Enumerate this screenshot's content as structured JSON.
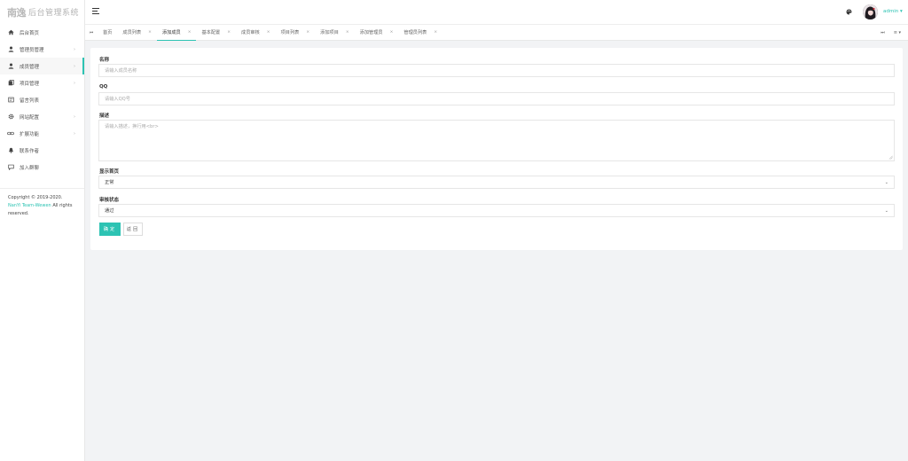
{
  "sidebar": {
    "logo_mark": "南逸",
    "logo_text": "后台管理系统",
    "items": [
      {
        "label": "后台首页",
        "icon": "home-icon",
        "arrow": false
      },
      {
        "label": "管理员管理",
        "icon": "user-icon",
        "arrow": true
      },
      {
        "label": "成员管理",
        "icon": "user-icon",
        "arrow": true
      },
      {
        "label": "项目管理",
        "icon": "project-icon",
        "arrow": true
      },
      {
        "label": "留言列表",
        "icon": "message-icon",
        "arrow": false
      },
      {
        "label": "网站配置",
        "icon": "gear-icon",
        "arrow": true
      },
      {
        "label": "扩展功能",
        "icon": "link-icon",
        "arrow": true
      },
      {
        "label": "联系作者",
        "icon": "bell-icon",
        "arrow": false
      },
      {
        "label": "加入群聊",
        "icon": "chat-icon",
        "arrow": false
      }
    ],
    "active_index": 2,
    "copyright": {
      "prefix": "Copyright © 2019-2020.",
      "link": "NanYi Team-Wewen",
      "suffix": "All rights reserved."
    }
  },
  "header": {
    "user_name": "admin ▾"
  },
  "tabs": {
    "left_scroll": "⏮",
    "items": [
      {
        "label": "首页",
        "closable": false
      },
      {
        "label": "成员列表",
        "closable": true
      },
      {
        "label": "添加成员",
        "closable": true
      },
      {
        "label": "基本配置",
        "closable": true
      },
      {
        "label": "成员审核",
        "closable": true
      },
      {
        "label": "项目列表",
        "closable": true
      },
      {
        "label": "添加项目",
        "closable": true
      },
      {
        "label": "添加管理员",
        "closable": true
      },
      {
        "label": "管理员列表",
        "closable": true
      }
    ],
    "active_index": 2,
    "close_glyph": "×",
    "right_scroll": "⏭",
    "menu": "≡ ▾"
  },
  "form": {
    "name": {
      "label": "名称",
      "placeholder": "请输入成员名称",
      "value": ""
    },
    "qq": {
      "label": "QQ",
      "placeholder": "请输入QQ号",
      "value": ""
    },
    "desc": {
      "label": "描述",
      "placeholder": "请输入描述，换行用<br>",
      "value": ""
    },
    "display": {
      "label": "显示首页",
      "value": "正常"
    },
    "review": {
      "label": "审核状态",
      "value": "通过"
    },
    "submit_label": "确定",
    "back_label": "返回"
  },
  "colors": {
    "accent": "#2dc3b3"
  }
}
